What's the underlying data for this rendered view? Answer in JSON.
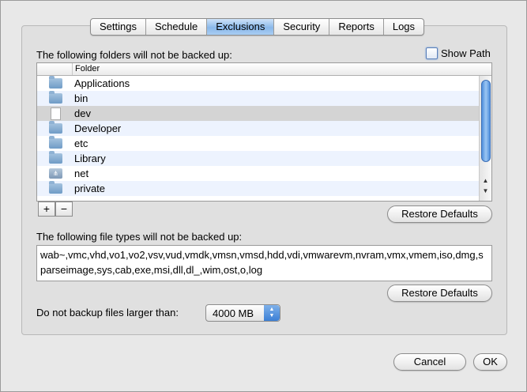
{
  "tabs": [
    "Settings",
    "Schedule",
    "Exclusions",
    "Security",
    "Reports",
    "Logs"
  ],
  "active_tab": "Exclusions",
  "folders_label": "The following folders will not be backed up:",
  "show_path_label": "Show Path",
  "table": {
    "header_folder": "Folder",
    "rows": [
      {
        "name": "Applications",
        "icon": "app-folder-icon"
      },
      {
        "name": "bin",
        "icon": "folder-icon"
      },
      {
        "name": "dev",
        "icon": "file-icon"
      },
      {
        "name": "Developer",
        "icon": "app-folder-icon"
      },
      {
        "name": "etc",
        "icon": "folder-icon"
      },
      {
        "name": "Library",
        "icon": "library-folder-icon"
      },
      {
        "name": "net",
        "icon": "network-icon"
      },
      {
        "name": "private",
        "icon": "folder-icon"
      }
    ]
  },
  "add_label": "+",
  "remove_label": "−",
  "restore_defaults_label": "Restore Defaults",
  "file_types_label": "The following file types will not be backed up:",
  "file_types_value": "wab~,vmc,vhd,vo1,vo2,vsv,vud,vmdk,vmsn,vmsd,hdd,vdi,vmwarevm,nvram,vmx,vmem,iso,dmg,sparseimage,sys,cab,exe,msi,dll,dl_,wim,ost,o,log",
  "size_label": "Do not backup files larger than:",
  "size_value": "4000 MB",
  "cancel_label": "Cancel",
  "ok_label": "OK"
}
